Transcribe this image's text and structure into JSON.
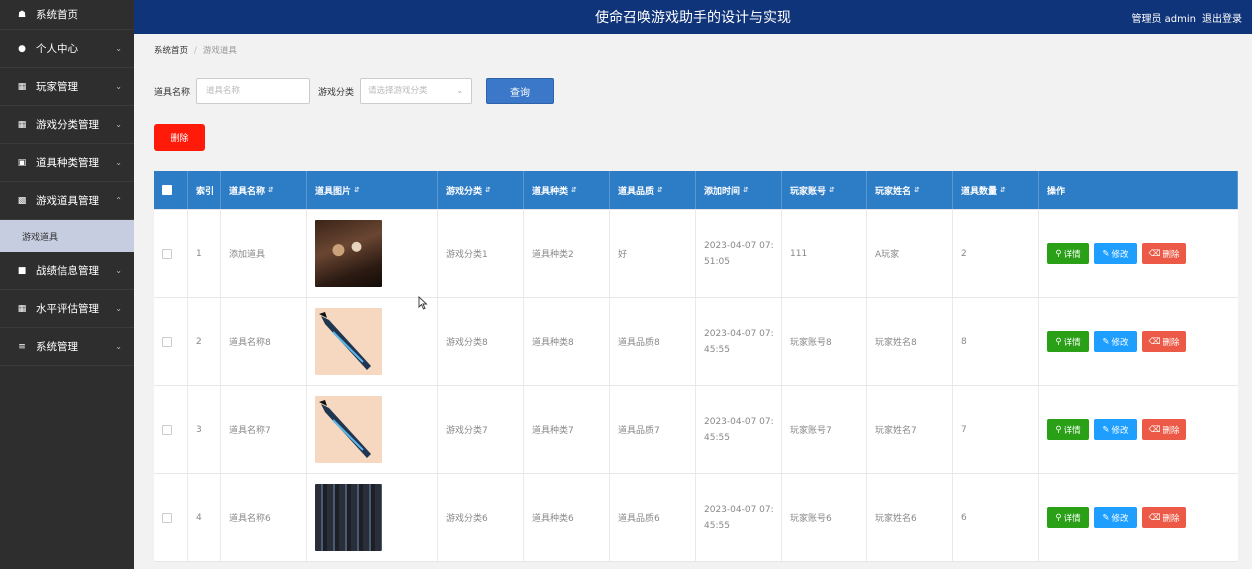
{
  "header": {
    "title": "使命召唤游戏助手的设计与实现",
    "role_user": "管理员 admin",
    "logout": "退出登录"
  },
  "sidebar": {
    "items": [
      {
        "icon": "home-icon",
        "label": "系统首页"
      },
      {
        "icon": "user-icon",
        "label": "个人中心"
      },
      {
        "icon": "grid-icon",
        "label": "玩家管理"
      },
      {
        "icon": "grid-icon",
        "label": "游戏分类管理"
      },
      {
        "icon": "bag-icon",
        "label": "道具种类管理"
      },
      {
        "icon": "clipboard-icon",
        "label": "游戏道具管理"
      },
      {
        "icon": "chat-icon",
        "label": "战绩信息管理"
      },
      {
        "icon": "grid-icon",
        "label": "水平评估管理"
      },
      {
        "icon": "sliders-icon",
        "label": "系统管理"
      }
    ],
    "sub_active": "游戏道具"
  },
  "breadcrumb": {
    "home": "系统首页",
    "current": "游戏道具"
  },
  "search": {
    "name_label": "道具名称",
    "name_placeholder": "道具名称",
    "category_label": "游戏分类",
    "category_placeholder": "请选择游戏分类",
    "query_button": "查询"
  },
  "delete_button": "删除",
  "table": {
    "headers": [
      "索引",
      "道具名称",
      "道具图片",
      "游戏分类",
      "道具种类",
      "道具品质",
      "添加时间",
      "玩家账号",
      "玩家姓名",
      "道具数量",
      "操作"
    ],
    "rows": [
      {
        "index": "1",
        "name": "添加道具",
        "category": "游戏分类1",
        "type": "道具种类2",
        "quality": "好",
        "time1": "2023-04-07 07:",
        "time2": "51:05",
        "account": "111",
        "player": "A玩家",
        "count": "2"
      },
      {
        "index": "2",
        "name": "道具名称8",
        "category": "游戏分类8",
        "type": "道具种类8",
        "quality": "道具品质8",
        "time1": "2023-04-07 07:",
        "time2": "45:55",
        "account": "玩家账号8",
        "player": "玩家姓名8",
        "count": "8"
      },
      {
        "index": "3",
        "name": "道具名称7",
        "category": "游戏分类7",
        "type": "道具种类7",
        "quality": "道具品质7",
        "time1": "2023-04-07 07:",
        "time2": "45:55",
        "account": "玩家账号7",
        "player": "玩家姓名7",
        "count": "7"
      },
      {
        "index": "4",
        "name": "道具名称6",
        "category": "游戏分类6",
        "type": "道具种类6",
        "quality": "道具品质6",
        "time1": "2023-04-07 07:",
        "time2": "45:55",
        "account": "玩家账号6",
        "player": "玩家姓名6",
        "count": "6"
      }
    ],
    "ops": {
      "detail": "详情",
      "edit": "修改",
      "remove": "删除"
    }
  }
}
